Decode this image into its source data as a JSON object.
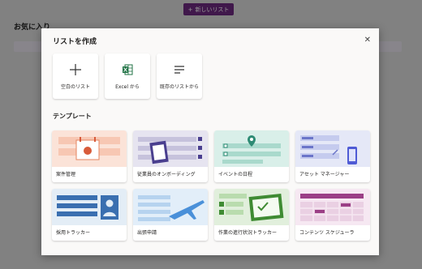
{
  "background": {
    "new_list_button": "新しいリスト",
    "favorites_title": "お気に入り"
  },
  "dialog": {
    "title": "リストを作成",
    "close_icon": "close-icon",
    "create_options": [
      {
        "label": "空白のリスト",
        "icon": "plus-icon"
      },
      {
        "label": "Excel から",
        "icon": "excel-icon"
      },
      {
        "label": "既存のリストから",
        "icon": "list-lines-icon"
      }
    ],
    "templates_title": "テンプレート",
    "templates": [
      {
        "label": "案件管理",
        "color": "#fbe3d8"
      },
      {
        "label": "従業員のオンボーディング",
        "color": "#e6e4f0"
      },
      {
        "label": "イベントの日程",
        "color": "#d9efe9"
      },
      {
        "label": "アセット マネージャー",
        "color": "#e5e8f7"
      },
      {
        "label": "採用トラッカー",
        "color": "#e3edf6"
      },
      {
        "label": "出張申請",
        "color": "#e2eef9"
      },
      {
        "label": "作業の進行状況トラッカー",
        "color": "#e1efdc"
      },
      {
        "label": "コンテンツ スケジューラ",
        "color": "#f6e8f2"
      }
    ]
  },
  "colors": {
    "accent": "#6e2a82"
  }
}
